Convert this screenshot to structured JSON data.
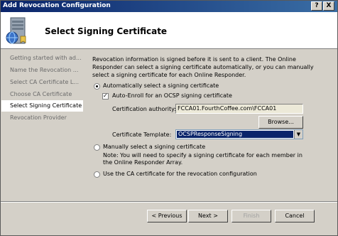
{
  "window": {
    "title": "Add Revocation Configuration",
    "help_label": "?",
    "close_label": "X"
  },
  "header": {
    "title": "Select Signing Certificate",
    "icon": "server-certificate-icon"
  },
  "nav": {
    "items": [
      {
        "label": "Getting started with ad..."
      },
      {
        "label": "Name the Revocation ..."
      },
      {
        "label": "Select CA Certificate L..."
      },
      {
        "label": "Choose CA Certificate"
      },
      {
        "label": "Select Signing Certificate"
      },
      {
        "label": "Revocation Provider"
      }
    ]
  },
  "main": {
    "description": "Revocation information is signed before it is sent to a client. The Online Responder can select a signing certificate automatically, or you can manually select a signing certificate for each Online Responder.",
    "auto_radio_label": "Automatically select a signing certificate",
    "auto_enroll_label": "Auto-Enroll for an OCSP signing certificate",
    "ca_label": "Certification authority:",
    "ca_value": "FCCA01.FourthCoffee.com\\FCCA01",
    "browse_label": "Browse...",
    "template_label": "Certificate Template:",
    "template_value": "OCSPResponseSigning",
    "manual_radio_label": "Manually select a signing certificate",
    "manual_note": "Note: You will need to specify a signing certificate for each member in the Online Responder Array.",
    "ca_cert_radio_label": "Use the CA certificate for the revocation configuration"
  },
  "footer": {
    "previous_label": "< Previous",
    "next_label": "Next >",
    "finish_label": "Finish",
    "cancel_label": "Cancel"
  }
}
